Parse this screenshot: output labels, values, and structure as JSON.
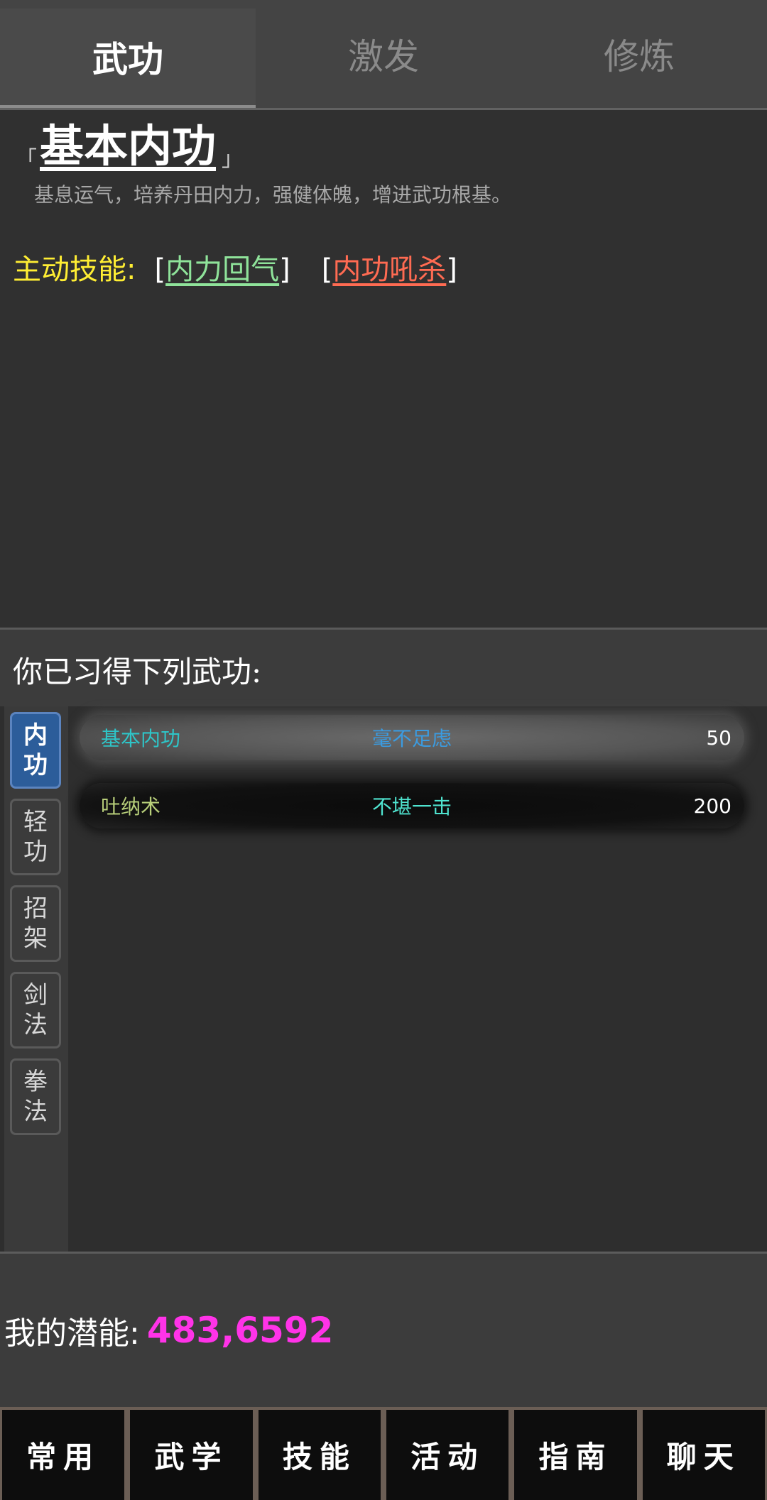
{
  "tabs": [
    {
      "label": "武功",
      "active": true
    },
    {
      "label": "激发",
      "active": false
    },
    {
      "label": "修炼",
      "active": false
    }
  ],
  "detail": {
    "open_bracket": "「",
    "title": "基本内功",
    "close_bracket": "」",
    "description": "基息运气，培养丹田内力，强健体魄，增进武功根基。",
    "active_label": "主动技能:",
    "active_skills": [
      {
        "name": "内力回气",
        "color": "#8fe39a"
      },
      {
        "name": "内功吼杀",
        "color": "#ff6b52"
      }
    ]
  },
  "learned": {
    "title": "你已习得下列武功:",
    "categories": [
      {
        "label": "内功",
        "active": true
      },
      {
        "label": "轻功",
        "active": false
      },
      {
        "label": "招架",
        "active": false
      },
      {
        "label": "剑法",
        "active": false
      },
      {
        "label": "拳法",
        "active": false
      }
    ],
    "rows": [
      {
        "name": "基本内功",
        "level": "毫不足虑",
        "value": "50"
      },
      {
        "name": "吐纳术",
        "level": "不堪一击",
        "value": "200"
      }
    ]
  },
  "potential": {
    "label": "我的潜能:",
    "value": "483,6592",
    "color": "#ff33e8"
  },
  "bottom_nav": [
    {
      "label": "常用"
    },
    {
      "label": "武学"
    },
    {
      "label": "技能"
    },
    {
      "label": "活动"
    },
    {
      "label": "指南"
    },
    {
      "label": "聊天"
    }
  ]
}
